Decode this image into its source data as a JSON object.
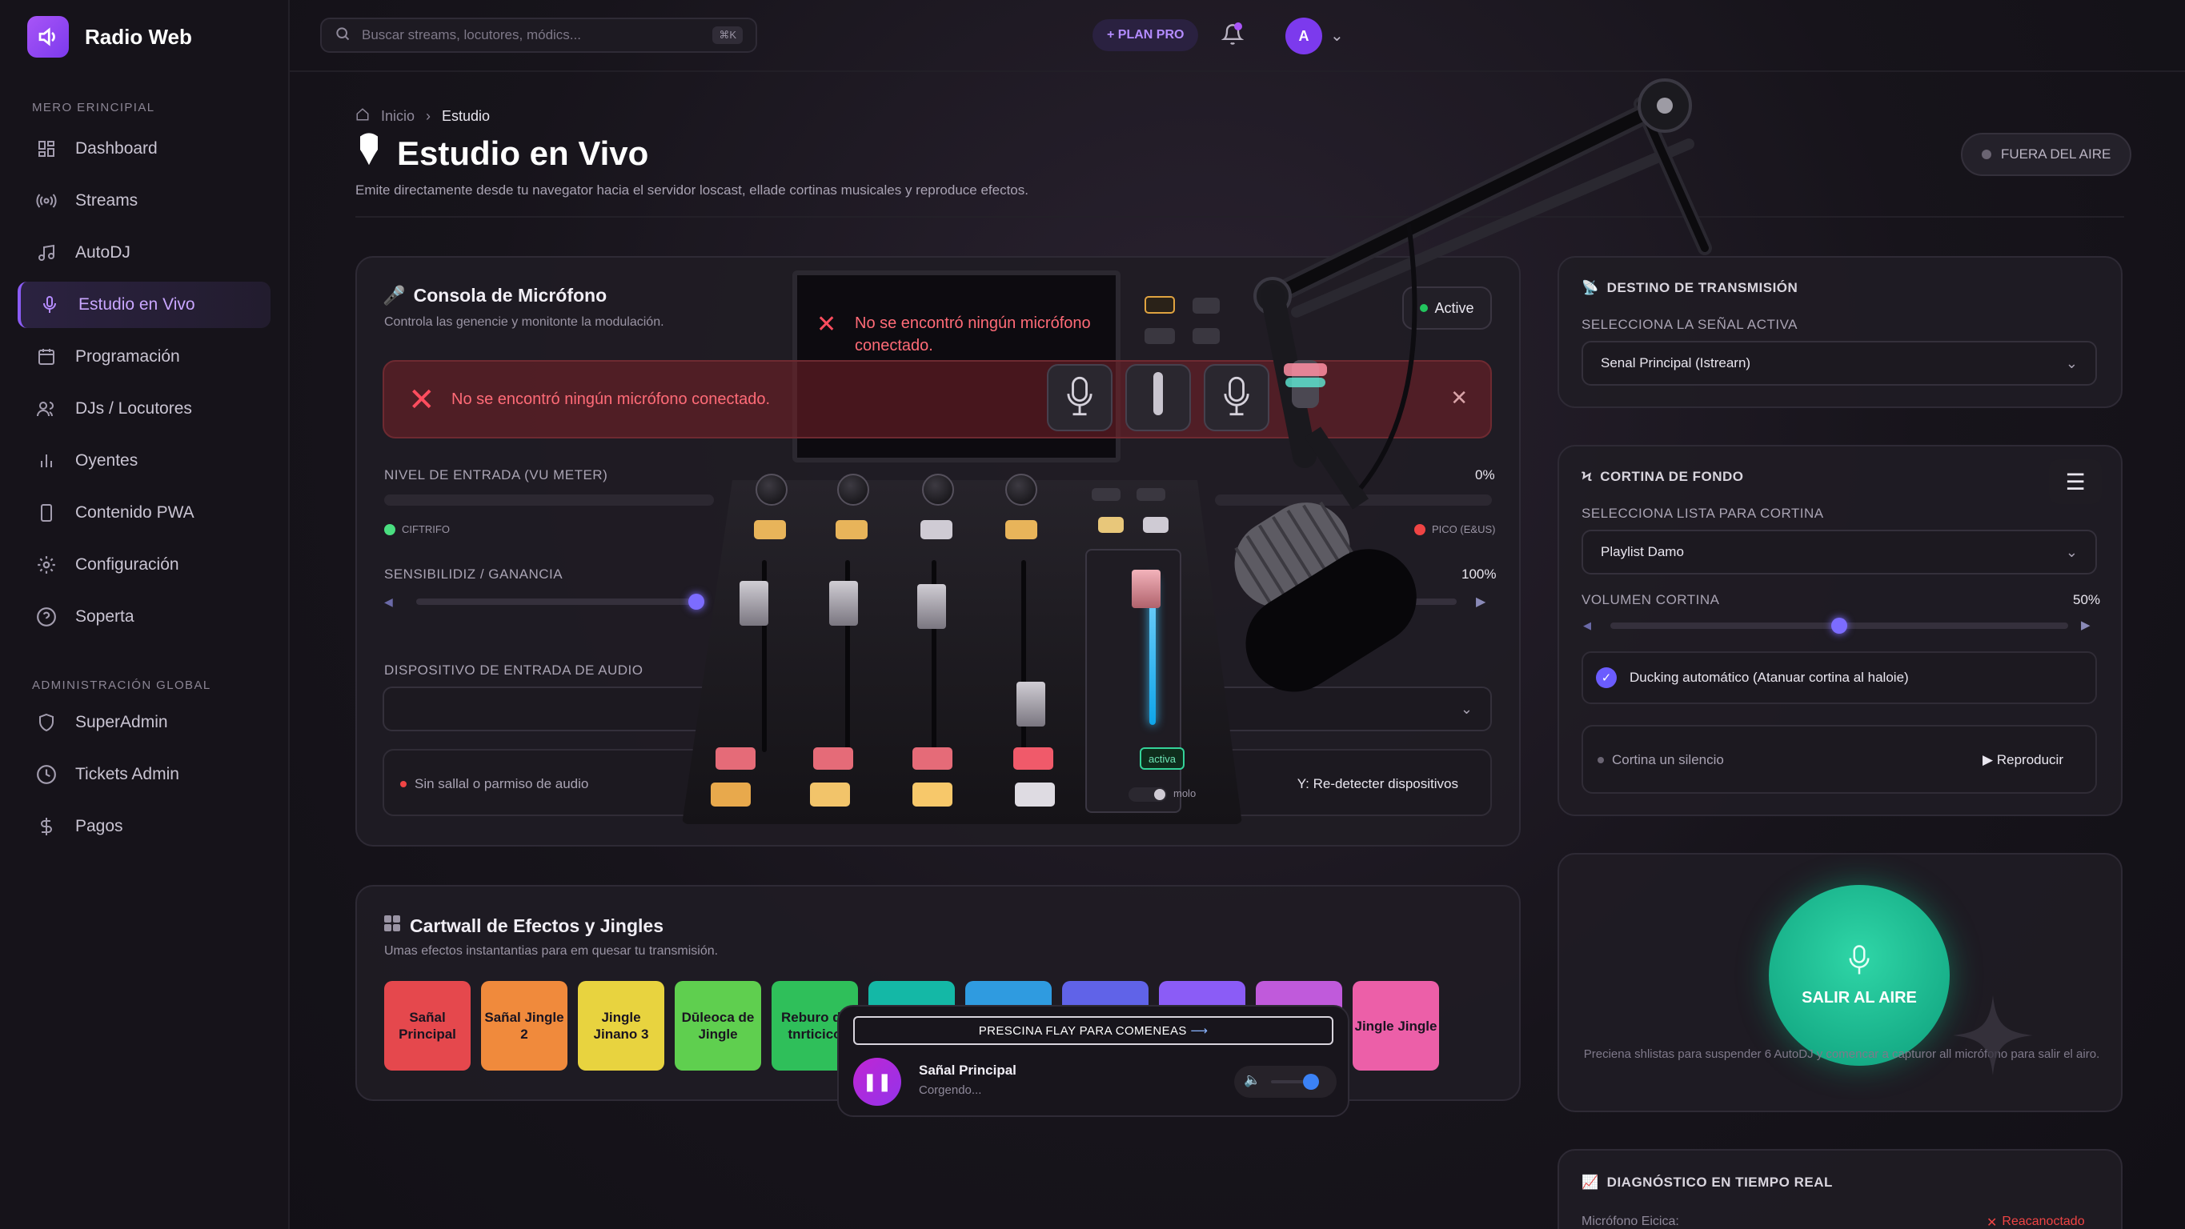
{
  "app": {
    "name": "Radio Web"
  },
  "search": {
    "placeholder": "Buscar streams, locutores, módics...",
    "shortcut": "⌘K"
  },
  "topbar": {
    "plan_label": "+ PLAN PRO",
    "avatar_initial": "A"
  },
  "sidebar": {
    "section_main": "MERO ERINCIPIAL",
    "items": [
      {
        "label": "Dashboard",
        "icon": "dashboard-icon"
      },
      {
        "label": "Streams",
        "icon": "broadcast-icon"
      },
      {
        "label": "AutoDJ",
        "icon": "music-note-icon"
      },
      {
        "label": "Estudio en Vivo",
        "icon": "microphone-icon",
        "active": true
      },
      {
        "label": "Programación",
        "icon": "calendar-icon"
      },
      {
        "label": "DJs / Locutores",
        "icon": "users-icon"
      },
      {
        "label": "Oyentes",
        "icon": "bar-chart-icon"
      },
      {
        "label": "Contenido PWA",
        "icon": "phone-icon"
      },
      {
        "label": "Configuración",
        "icon": "gear-icon"
      },
      {
        "label": "Soperta",
        "icon": "help-icon"
      }
    ],
    "section_admin": "ADMINISTRACIÓN GLOBAL",
    "admin_items": [
      {
        "label": "SuperAdmin",
        "icon": "shield-icon"
      },
      {
        "label": "Tickets Admin",
        "icon": "clock-icon"
      },
      {
        "label": "Pagos",
        "icon": "dollar-icon"
      }
    ]
  },
  "header": {
    "breadcrumb": [
      "Inicio",
      "Estudio"
    ],
    "title": "Estudio en Vivo",
    "subtitle": "Emite directamente desde tu navegator hacia el servidor loscast, ellade cortinas musicales y reproduce efectos.",
    "off_air_label": "FUERA DEL AIRE"
  },
  "mic_console": {
    "title": "Consola de Micrófono",
    "subtitle": "Controla las genencie y monitonte la modulación.",
    "status_pill": "Active",
    "screen_error": "No se encontró ningún micrófono conectado.",
    "alert_text": "No se encontró ningún micrófono conectado.",
    "vu_label": "NIVEL DE ENTRADA (VU METER)",
    "vu_value": "0%",
    "vu_level": 0,
    "legend_left": "CIFTRIFO",
    "legend_right": "PICO (E&US)",
    "gain_label": "SENSIBILIDIZ / GANANCIA",
    "gain_value": "100%",
    "gain_level": 1.0,
    "device_label": "DISPOSITIVO DE ENTRADA DE AUDIO",
    "device_status": "Sin sallal o parmiso de audio",
    "redetect_label": "Y: Re-detecter dispositivos",
    "channel_activa_label": "activa",
    "channel_molo_label": "molo",
    "colors": {
      "alert": "#ff4d5e",
      "accent": "#7c6cff"
    }
  },
  "cartwall": {
    "title": "Cartwall de Efectos y Jingles",
    "subtitle": "Umas efectos instantantias para em quesar tu transmisión.",
    "pads": [
      {
        "label": "Sañal Principal",
        "color": "#e5484d"
      },
      {
        "label": "Sañal Jingle 2",
        "color": "#f08a3c"
      },
      {
        "label": "Jingle Jinano 3",
        "color": "#e8d33f"
      },
      {
        "label": "Dūleoca de Jingle",
        "color": "#5fcf4f"
      },
      {
        "label": "Reburo de tnrticico",
        "color": "#2fbf5a"
      },
      {
        "label": "",
        "color": "#14b8a6"
      },
      {
        "label": "",
        "color": "#2f9be0"
      },
      {
        "label": "",
        "color": "#6063e8"
      },
      {
        "label": "",
        "color": "#8b5cf6"
      },
      {
        "label": "Jingle Jingle",
        "color": "#c05adb"
      },
      {
        "label": "Jingle Jingle",
        "color": "#ec5fa8"
      }
    ]
  },
  "player": {
    "banner": "PRESCINA FLAY PARA COMENEAS",
    "title": "Sañal Principal",
    "subtitle": "Corgendo..."
  },
  "destination": {
    "title": "DESTINO DE TRANSMISIÓN",
    "label": "SELECCIONA LA SEÑAL ACTIVA",
    "selected": "Senal Principal (Istrearn)"
  },
  "background_curtain": {
    "title": "CORTINA DE FONDO",
    "label": "SELECCIONA LISTA PARA CORTINA",
    "selected": "Playlist Damo",
    "volume_label": "VOLUMEN CORTINA",
    "volume_value": "50%",
    "volume_level": 0.5,
    "ducking_label": "Ducking automático (Atanuar cortina al haloie)",
    "ducking_checked": true,
    "status": "Cortina un silencio",
    "play_label": "▶ Reproducir"
  },
  "on_air": {
    "button_label": "SALIR AL AIRE",
    "caption": "Preciena shlistas para suspender 6 AutoDJ y comencar a capturor all micrófono para salir el airo."
  },
  "diagnostics": {
    "title": "DIAGNÓSTICO EN TIEMPO REAL",
    "row_label": "Micrófono Eicica:",
    "row_value": "Reacanoctado"
  }
}
